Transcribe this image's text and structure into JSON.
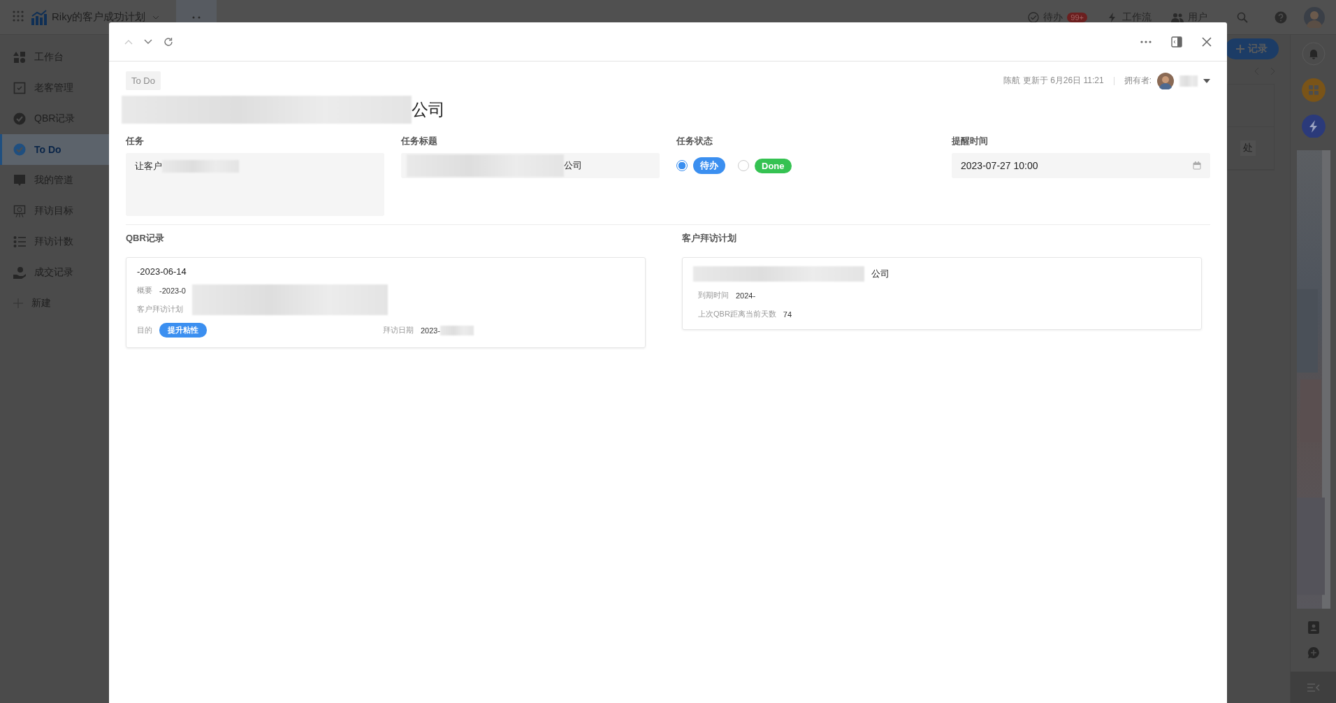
{
  "app_bar": {
    "title": "Riky的客户成功计划",
    "todo_label": "待办",
    "todo_badge": "99+",
    "workflow_label": "工作流",
    "users_label": "用户"
  },
  "sidebar": {
    "items": [
      {
        "label": "工作台",
        "selected": false
      },
      {
        "label": "老客管理",
        "selected": false
      },
      {
        "label": "QBR记录",
        "selected": false
      },
      {
        "label": "To Do",
        "selected": true
      },
      {
        "label": "我的管道",
        "selected": false
      },
      {
        "label": "拜访目标",
        "selected": false
      },
      {
        "label": "拜访计数",
        "selected": false
      },
      {
        "label": "成交记录",
        "selected": false
      }
    ],
    "new_item": "新建"
  },
  "background": {
    "add_button": "记录",
    "cell_text": "处"
  },
  "modal": {
    "tag": "To Do",
    "updated": "陈航 更新于 6月26日 11:21",
    "owner_label": "拥有者:",
    "title": "公司",
    "fields": [
      {
        "kind": "area",
        "label": "任务",
        "value": "让客户"
      },
      {
        "kind": "text",
        "label": "任务标题",
        "value": "公司"
      },
      {
        "kind": "status",
        "label": "任务状态",
        "options": [
          {
            "label": "待办",
            "selected": true,
            "color": "#3b8ff0"
          },
          {
            "label": "Done",
            "selected": false,
            "color": "#35c252"
          }
        ]
      },
      {
        "kind": "date",
        "label": "提醒时间",
        "value": "2023-07-27 10:00"
      }
    ],
    "qbr": {
      "label": "QBR记录",
      "title": "-2023-06-14",
      "summary_label": "概要",
      "summary_value": "-2023-0",
      "plan_label": "客户拜访计划",
      "purpose_label": "目的",
      "purpose_tag": "提升粘性",
      "date_label": "拜访日期",
      "date_value": "2023-"
    },
    "visit_plan": {
      "label": "客户拜访计划",
      "title": "公司",
      "rows": [
        {
          "label": "到期时间",
          "value": "2024-"
        },
        {
          "label": "上次QBR距离当前天数",
          "value": "74"
        }
      ]
    }
  }
}
